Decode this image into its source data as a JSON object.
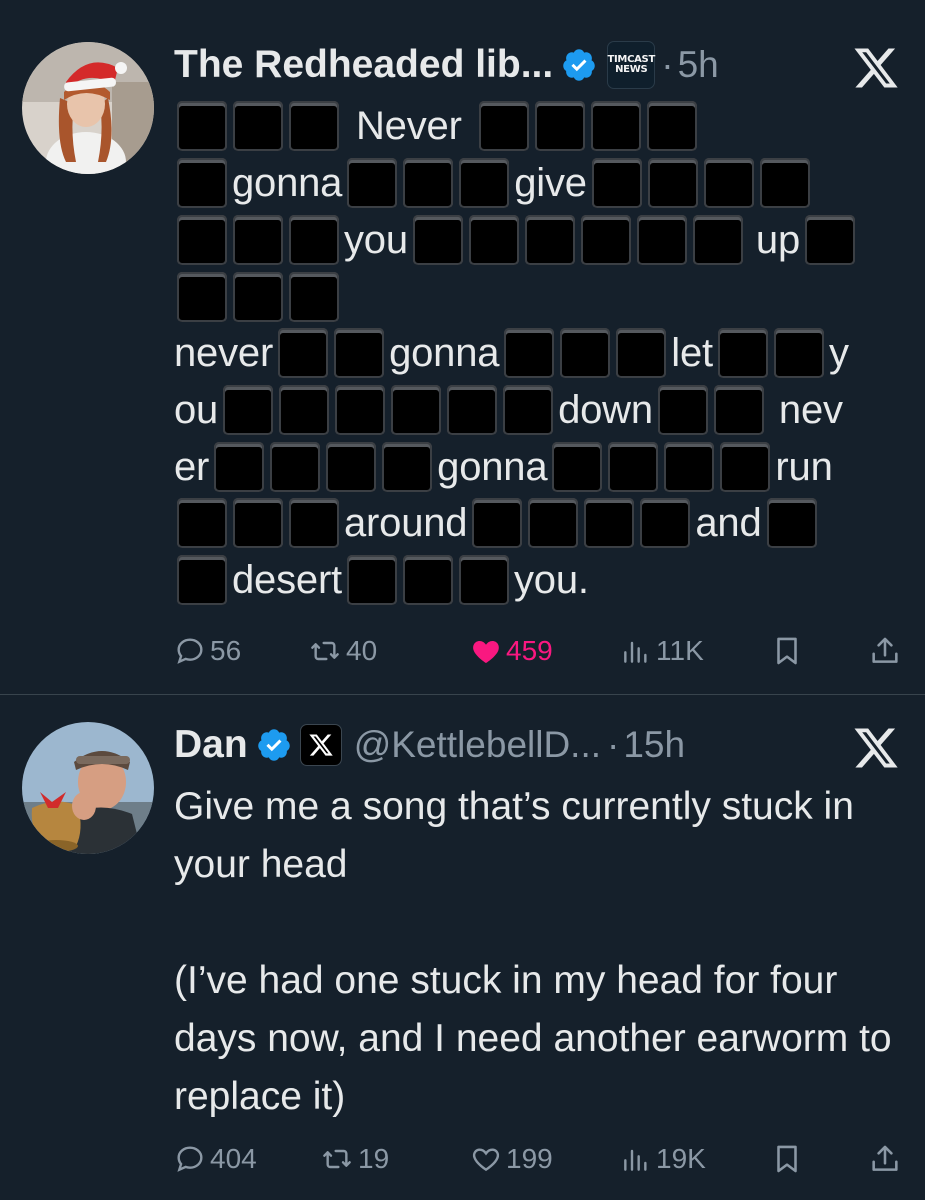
{
  "tweets": [
    {
      "author": "The Redheaded lib...",
      "affiliation_badge": "TIMCAST NEWS",
      "affiliation_line1": "TIMCAST",
      "affiliation_line2": "NEWS",
      "separator": "·",
      "time": "5h",
      "lyric_words": [
        "Never",
        "gonna",
        "give",
        "you",
        "up",
        "never",
        "gonna",
        "let",
        "y",
        "ou",
        "down",
        "nev",
        "er",
        "gonna",
        "run",
        "around",
        "and",
        "desert",
        "you."
      ],
      "stats": {
        "replies": "56",
        "retweets": "40",
        "likes": "459",
        "views": "11K"
      }
    },
    {
      "author": "Dan",
      "handle": "@KettlebellD...",
      "separator": "·",
      "time": "15h",
      "body_paragraph_1": "Give me a song that’s currently stuck in your head",
      "body_paragraph_2": "(I’ve had one stuck in my head for four days now, and I need another earworm to replace it)",
      "stats": {
        "replies": "404",
        "retweets": "19",
        "likes": "199",
        "views": "19K"
      }
    }
  ],
  "icons": {
    "verified": "verified-badge-icon",
    "platform": "x-logo-icon",
    "reply": "reply-icon",
    "retweet": "retweet-icon",
    "like": "heart-icon",
    "views": "views-icon",
    "bookmark": "bookmark-icon",
    "share": "share-icon"
  },
  "colors": {
    "background": "#15202b",
    "text": "#e7e9ea",
    "muted": "#8b98a5",
    "verified": "#1d9bf0",
    "liked": "#f91880",
    "divider": "#38444d"
  }
}
